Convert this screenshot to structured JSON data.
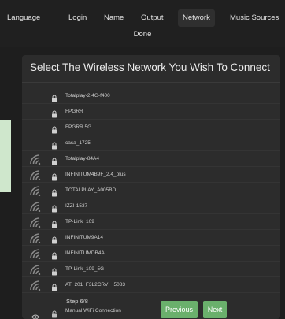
{
  "nav": {
    "tabs": [
      {
        "label": "Language",
        "active": false
      },
      {
        "label": "Login",
        "active": false
      },
      {
        "label": "Name",
        "active": false
      },
      {
        "label": "Output",
        "active": false
      },
      {
        "label": "Network",
        "active": true
      },
      {
        "label": "Music Sources",
        "active": false
      }
    ],
    "done_label": "Done"
  },
  "panel": {
    "title": "Select The Wireless Network You Wish To Connect",
    "networks": [
      {
        "name": "Totalplay-2.4G-f400",
        "wifi_icon": false,
        "lock_icon": true
      },
      {
        "name": "FPGRR",
        "wifi_icon": false,
        "lock_icon": true
      },
      {
        "name": "FPGRR 5G",
        "wifi_icon": false,
        "lock_icon": true
      },
      {
        "name": "casa_1725",
        "wifi_icon": false,
        "lock_icon": true
      },
      {
        "name": "Totalplay-84A4",
        "wifi_icon": true,
        "lock_icon": true
      },
      {
        "name": "INFINITUM4B9F_2.4_plus",
        "wifi_icon": true,
        "lock_icon": true
      },
      {
        "name": "TOTALPLAY_A005BD",
        "wifi_icon": true,
        "lock_icon": true
      },
      {
        "name": "IZZI-1537",
        "wifi_icon": true,
        "lock_icon": true
      },
      {
        "name": "TP-Link_109",
        "wifi_icon": true,
        "lock_icon": true
      },
      {
        "name": "INFINITUM9A14",
        "wifi_icon": true,
        "lock_icon": true
      },
      {
        "name": "INFINITUMDB4A",
        "wifi_icon": true,
        "lock_icon": true
      },
      {
        "name": "TP-Link_109_5G",
        "wifi_icon": true,
        "lock_icon": true
      },
      {
        "name": "AT_201_F3L2CRV__5083",
        "wifi_icon": true,
        "lock_icon": true
      }
    ],
    "manual_connection": {
      "name": "Manual WiFi Connection",
      "icon": "eye-icon"
    },
    "step_label": "Step 6/8"
  },
  "buttons": {
    "previous_label": "Previous",
    "next_label": "Next"
  },
  "colors": {
    "background": "#1e1e1e",
    "panel": "#2c2c2c",
    "accent_green": "#6ab06c",
    "left_accent": "#cfe7cc"
  }
}
